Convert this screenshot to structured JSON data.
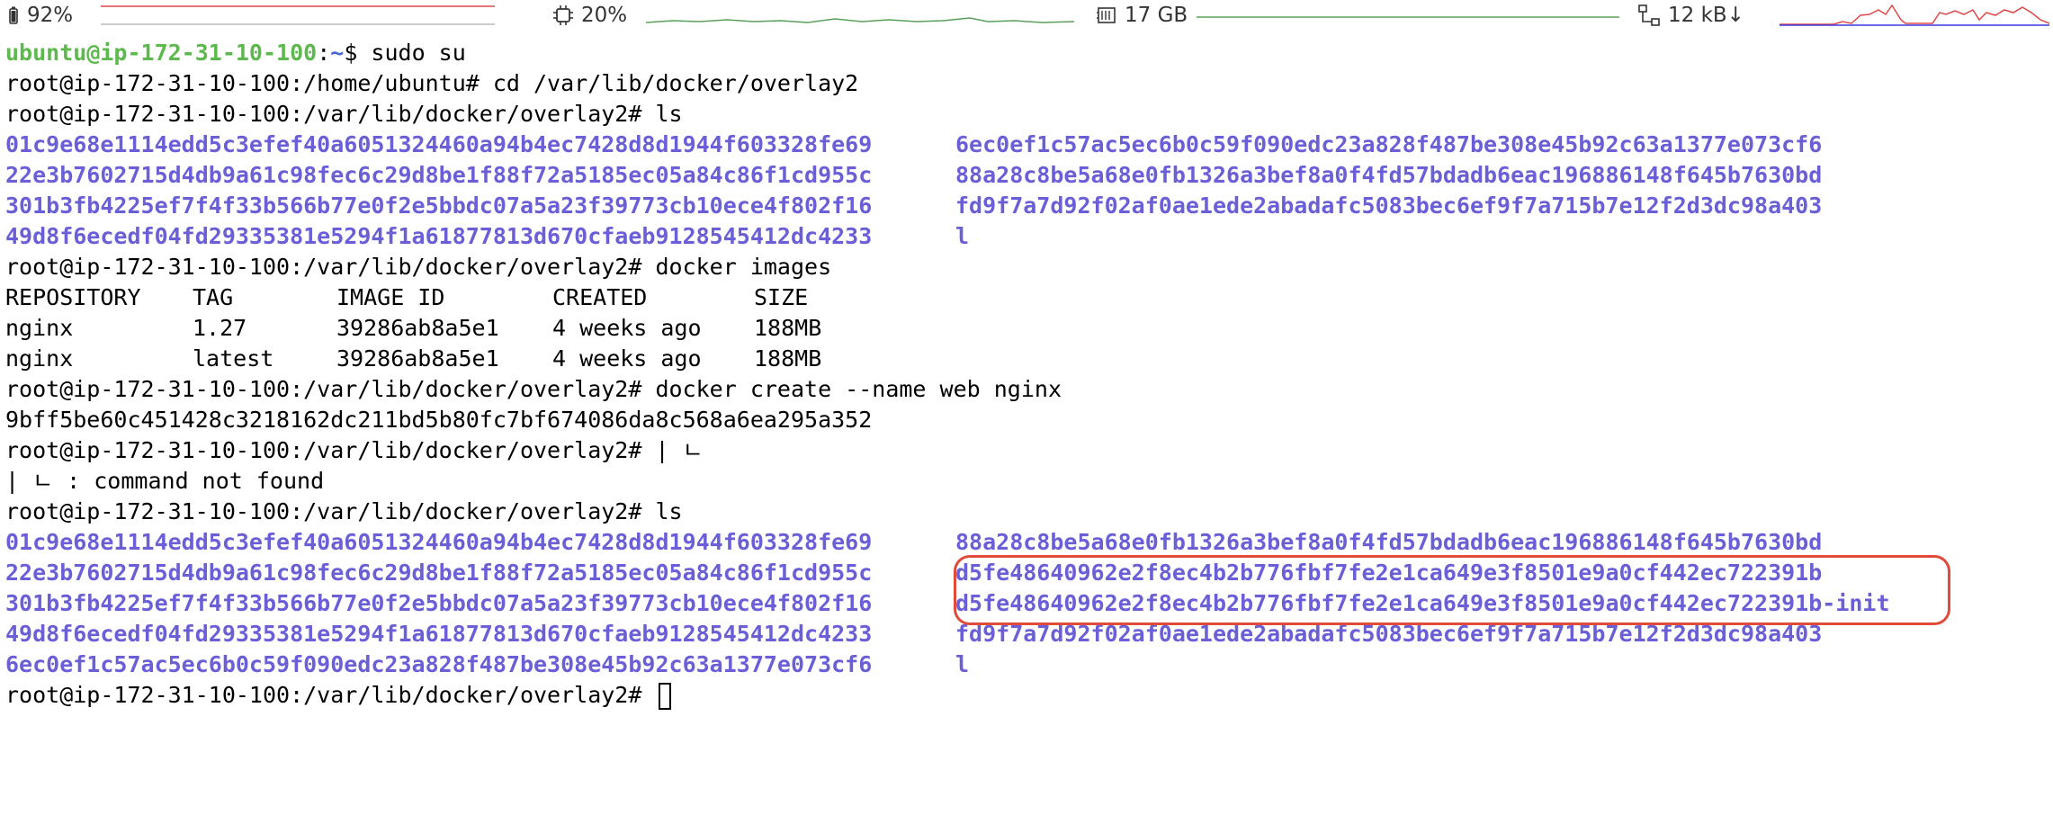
{
  "statusbar": {
    "battery": {
      "icon": "battery-icon",
      "value": "92%",
      "color": "#d94848"
    },
    "cpu": {
      "icon": "cpu-icon",
      "value": "20%",
      "color": "#4caf50"
    },
    "memory": {
      "icon": "memory-icon",
      "value": "17 GB",
      "color": "#4caf50"
    },
    "network": {
      "icon": "network-icon",
      "value": "12 kB↓",
      "color_down": "#3b3be0",
      "color_up": "#e04848"
    }
  },
  "terminal": {
    "l1_user": "ubuntu@ip-172-31-10-100",
    "l1_sep": ":",
    "l1_path": "~",
    "l1_cmd": "$ sudo su",
    "l2": "root@ip-172-31-10-100:/home/ubuntu# cd /var/lib/docker/overlay2",
    "l3": "root@ip-172-31-10-100:/var/lib/docker/overlay2# ls",
    "ls1": [
      [
        "01c9e68e1114edd5c3efef40a6051324460a94b4ec7428d8d1944f603328fe69",
        "6ec0ef1c57ac5ec6b0c59f090edc23a828f487be308e45b92c63a1377e073cf6"
      ],
      [
        "22e3b7602715d4db9a61c98fec6c29d8be1f88f72a5185ec05a84c86f1cd955c",
        "88a28c8be5a68e0fb1326a3bef8a0f4fd57bdadb6eac196886148f645b7630bd"
      ],
      [
        "301b3fb4225ef7f4f33b566b77e0f2e5bbdc07a5a23f39773cb10ece4f802f16",
        "fd9f7a7d92f02af0ae1ede2abadafc5083bec6ef9f7a715b7e12f2d3dc98a403"
      ],
      [
        "49d8f6ecedf04fd29335381e5294f1a61877813d670cfaeb9128545412dc4233",
        "l"
      ]
    ],
    "l8": "root@ip-172-31-10-100:/var/lib/docker/overlay2# docker images",
    "images_header": [
      "REPOSITORY",
      "TAG",
      "IMAGE ID",
      "CREATED",
      "SIZE"
    ],
    "images_rows": [
      [
        "nginx",
        "1.27",
        "39286ab8a5e1",
        "4 weeks ago",
        "188MB"
      ],
      [
        "nginx",
        "latest",
        "39286ab8a5e1",
        "4 weeks ago",
        "188MB"
      ]
    ],
    "l12": "root@ip-172-31-10-100:/var/lib/docker/overlay2# docker create --name web nginx",
    "l13": "9bff5be60c451428c3218162dc211bd5b80fc7bf674086da8c568a6ea295a352",
    "l14": "root@ip-172-31-10-100:/var/lib/docker/overlay2# | ㄴ",
    "l15": "| ㄴ : command not found",
    "l16": "root@ip-172-31-10-100:/var/lib/docker/overlay2# ls",
    "ls2": [
      [
        "01c9e68e1114edd5c3efef40a6051324460a94b4ec7428d8d1944f603328fe69",
        "88a28c8be5a68e0fb1326a3bef8a0f4fd57bdadb6eac196886148f645b7630bd"
      ],
      [
        "22e3b7602715d4db9a61c98fec6c29d8be1f88f72a5185ec05a84c86f1cd955c",
        "d5fe48640962e2f8ec4b2b776fbf7fe2e1ca649e3f8501e9a0cf442ec722391b"
      ],
      [
        "301b3fb4225ef7f4f33b566b77e0f2e5bbdc07a5a23f39773cb10ece4f802f16",
        "d5fe48640962e2f8ec4b2b776fbf7fe2e1ca649e3f8501e9a0cf442ec722391b-init"
      ],
      [
        "49d8f6ecedf04fd29335381e5294f1a61877813d670cfaeb9128545412dc4233",
        "fd9f7a7d92f02af0ae1ede2abadafc5083bec6ef9f7a715b7e12f2d3dc98a403"
      ],
      [
        "6ec0ef1c57ac5ec6b0c59f090edc23a828f487be308e45b92c63a1377e073cf6",
        "l"
      ]
    ],
    "l22": "root@ip-172-31-10-100:/var/lib/docker/overlay2# ",
    "highlight_color": "#e04b3a"
  }
}
